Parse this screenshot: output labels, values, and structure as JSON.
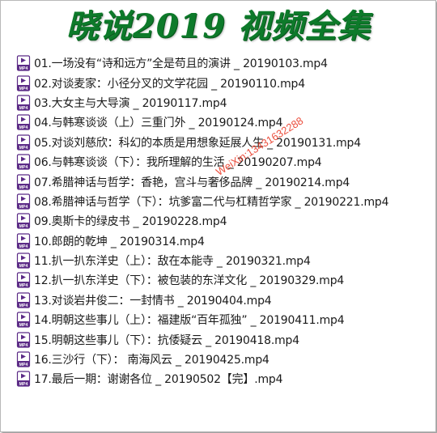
{
  "title": "晓说2019 视频全集",
  "watermark": "WeiXin:13431632288",
  "icon": {
    "name": "mp4-file-icon",
    "label": "MP4",
    "color": "#5b2a86"
  },
  "files": [
    "01.一场没有“诗和远方”全是苟且的演讲 _ 20190103.mp4",
    "02.对谈麦家：小径分叉的文学花园 _ 20190110.mp4",
    "03.大女主与大导演 _ 20190117.mp4",
    "04.与韩寒谈谈（上）三重门外 _ 20190124.mp4",
    "05.对谈刘慈欣：科幻的本质是用想象延展人生 _ 20190131.mp4",
    "06.与韩寒谈谈（下）：我所理解的生活 _ 20190207.mp4",
    "07.希腊神话与哲学：香艳，宫斗与奢侈品牌 _ 20190214.mp4",
    "08.希腊神话与哲学（下）：坑爹富二代与杠精哲学家 _ 20190221.mp4",
    "09.奥斯卡的绿皮书 _ 20190228.mp4",
    "10.郎朗的乾坤 _ 20190314.mp4",
    "11.扒一扒东洋史（上）：敌在本能寺 _ 20190321.mp4",
    "12.扒一扒东洋史（下）：被包装的东洋文化 _ 20190329.mp4",
    "13.对谈岩井俊二：一封情书 _ 20190404.mp4",
    "14.明朝这些事儿（上）：福建版“百年孤独” _ 20190411.mp4",
    "15.明朝这些事儿（下）：抗倭疑云 _ 20190418.mp4",
    "16.三沙行（下）： 南海风云 _ 20190425.mp4",
    "17.最后一期：谢谢各位 _ 20190502【完】.mp4"
  ]
}
